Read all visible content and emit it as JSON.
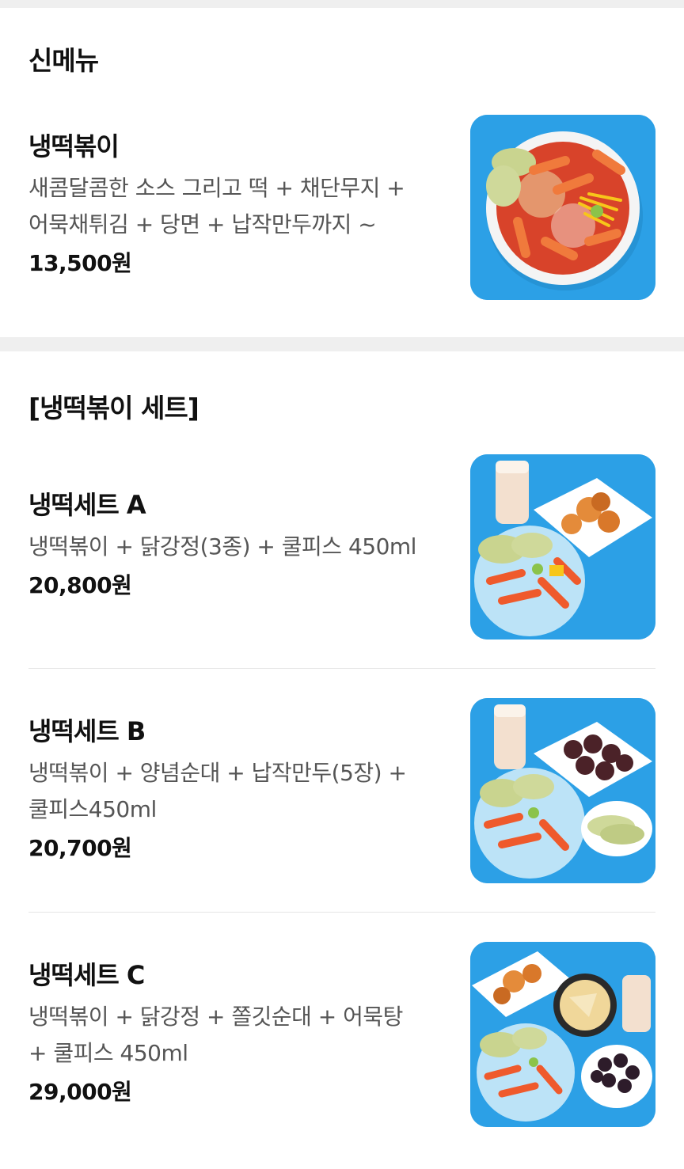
{
  "new_menu": {
    "title": "신메뉴",
    "items": [
      {
        "name": "냉떡볶이",
        "desc_line1": "새콤달콤한 소스 그리고 떡 + 채단무지 +",
        "desc_line2": "어묵채튀김 + 당면 + 납작만두까지 ~",
        "price": "13,500원"
      }
    ]
  },
  "set_menu": {
    "title": "[냉떡볶이 세트]",
    "items": [
      {
        "name": "냉떡세트 A",
        "desc_line1": "냉떡볶이 + 닭강정(3종) + 쿨피스 450ml",
        "desc_line2": "",
        "price": "20,800원"
      },
      {
        "name": "냉떡세트 B",
        "desc_line1": "냉떡볶이 + 양념순대 + 납작만두(5장) +",
        "desc_line2": "쿨피스450ml",
        "price": "20,700원"
      },
      {
        "name": "냉떡세트 C",
        "desc_line1": "냉떡볶이 + 닭강정 + 쫄깃순대 + 어묵탕",
        "desc_line2": "+ 쿨피스 450ml",
        "price": "29,000원"
      }
    ]
  },
  "colors": {
    "background": "#efefef",
    "card": "#ffffff",
    "image_bg": "#2ca0e6",
    "text": "#111111",
    "desc": "#555555"
  }
}
